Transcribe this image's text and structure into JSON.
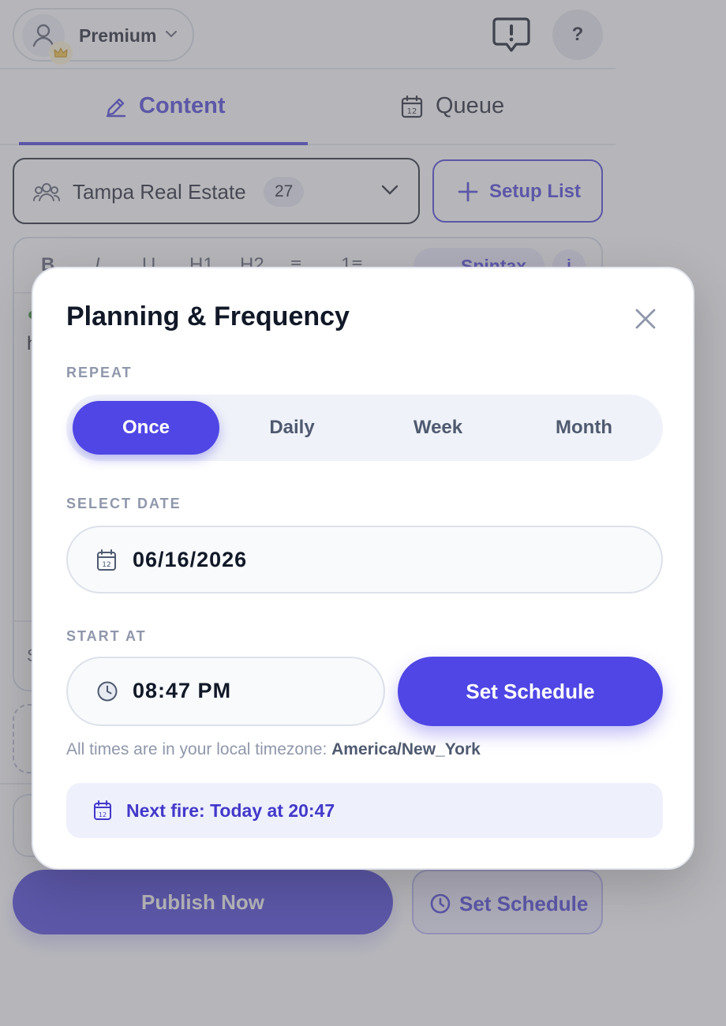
{
  "header": {
    "plan_label": "Premium",
    "help_label": "?"
  },
  "tabs": [
    {
      "label": "Content",
      "active": true
    },
    {
      "label": "Queue",
      "active": false
    }
  ],
  "list_selector": {
    "name": "Tampa Real Estate",
    "count": "27",
    "setup_label": "Setup List"
  },
  "editor": {
    "toolbar": [
      "B",
      "I",
      "U",
      "H1",
      "H2",
      "≡",
      "1≡"
    ],
    "spintax_label": "Spintax",
    "info_label": "i",
    "text_preview": "h",
    "footer_letter": "S"
  },
  "actions": {
    "publish_label": "Publish Now",
    "schedule_label": "Set Schedule"
  },
  "modal": {
    "title": "Planning & Frequency",
    "repeat_label": "REPEAT",
    "repeat_options": [
      "Once",
      "Daily",
      "Week",
      "Month"
    ],
    "repeat_selected": "Once",
    "date_label": "SELECT DATE",
    "date_value": "06/16/2026",
    "start_label": "START AT",
    "time_value": "08:47 PM",
    "set_schedule_label": "Set Schedule",
    "timezone_prefix": "All times are in your local timezone: ",
    "timezone_value": "America/New_York",
    "next_fire": "Next fire: Today at 20:47"
  },
  "colors": {
    "accent": "#4f46e5",
    "brand_dark": "#4b40d9",
    "muted": "#8f97ab"
  }
}
